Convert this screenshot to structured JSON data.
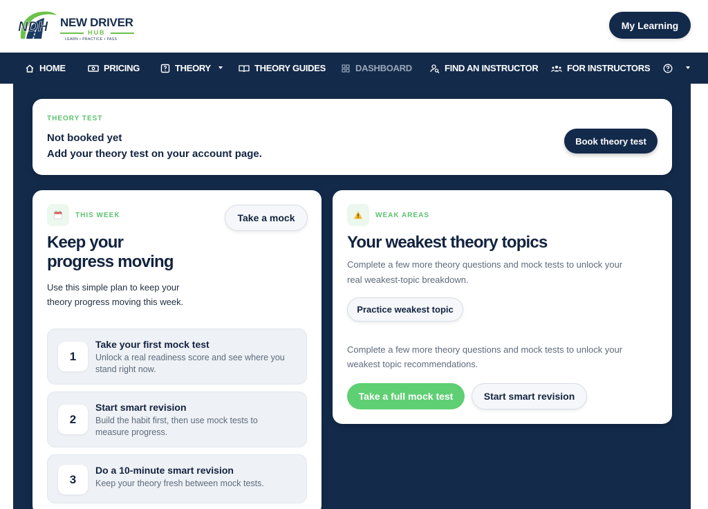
{
  "header": {
    "logo": {
      "mark": "NDH",
      "title": "NEW DRIVER",
      "hub": "HUB",
      "tagline": "LEARN • PRACTICE • PASS"
    },
    "my_learning": "My Learning"
  },
  "nav": {
    "items": [
      {
        "label": "HOME",
        "icon": "home-icon"
      },
      {
        "label": "PRICING",
        "icon": "ticket-icon"
      },
      {
        "label": "THEORY",
        "icon": "quiz-icon"
      },
      {
        "label": "THEORY GUIDES",
        "icon": "book-icon"
      },
      {
        "label": "DASHBOARD",
        "icon": "grid-icon"
      },
      {
        "label": "FIND AN INSTRUCTOR",
        "icon": "person-search-icon"
      },
      {
        "label": "FOR INSTRUCTORS",
        "icon": "group-icon"
      }
    ],
    "help_icon": "help-icon"
  },
  "theory_test": {
    "eyebrow": "THEORY TEST",
    "status": "Not booked yet",
    "message": "Add your theory test on your account page.",
    "button": "Book theory test"
  },
  "this_week": {
    "eyebrow": "THIS WEEK",
    "title_line1": "Keep your",
    "title_line2": "progress moving",
    "desc_line1": "Use this simple plan to keep your",
    "desc_line2": "theory progress moving this week.",
    "mock_button": "Take a mock",
    "steps": [
      {
        "num": "1",
        "title": "Take your first mock test",
        "desc_line1": "Unlock a real readiness score and see where you",
        "desc_line2": "stand right now."
      },
      {
        "num": "2",
        "title": "Start smart revision",
        "desc_line1": "Build the habit first, then use mock tests to",
        "desc_line2": "measure progress."
      },
      {
        "num": "3",
        "title": "Do a 10-minute smart revision",
        "desc_line1": "Keep your theory fresh between mock tests.",
        "desc_line2": ""
      }
    ]
  },
  "weak_areas": {
    "eyebrow": "WEAK AREAS",
    "title": "Your weakest theory topics",
    "desc1_line1": "Complete a few more theory questions and mock tests to unlock your",
    "desc1_line2": "real weakest-topic breakdown.",
    "practice_button": "Practice weakest topic",
    "desc2_line1": "Complete a few more theory questions and mock tests to unlock your",
    "desc2_line2": "weakest topic recommendations.",
    "full_mock_button": "Take a full mock test",
    "smart_revision_button": "Start smart revision"
  },
  "colors": {
    "navy": "#132a4a",
    "green": "#5fcf73",
    "eyebrow_green": "#5cc26f"
  }
}
